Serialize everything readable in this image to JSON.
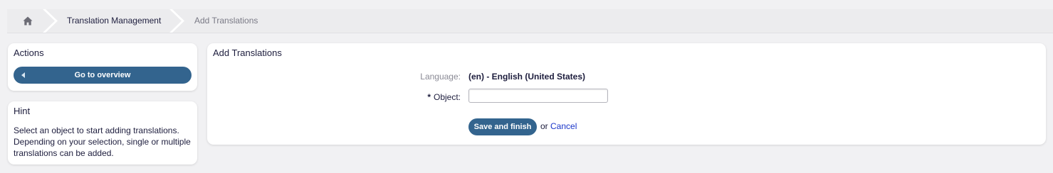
{
  "breadcrumb": {
    "home_icon": "home-icon",
    "items": [
      {
        "label": "Translation Management"
      },
      {
        "label": "Add Translations"
      }
    ]
  },
  "actions": {
    "title": "Actions",
    "overview_button": "Go to overview"
  },
  "hint": {
    "title": "Hint",
    "text": "Select an object to start adding translations. Depending on your selection, single or multiple translations can be added."
  },
  "form": {
    "title": "Add Translations",
    "language_label": "Language:",
    "language_value": "(en) - English (United States)",
    "required_marker": "*",
    "object_label": "Object:",
    "object_value": "",
    "save_button": "Save and finish",
    "or_text": "or",
    "cancel_link": "Cancel"
  },
  "colors": {
    "accent": "#33648e",
    "link": "#1a35c9",
    "background": "#f1f1f3"
  }
}
